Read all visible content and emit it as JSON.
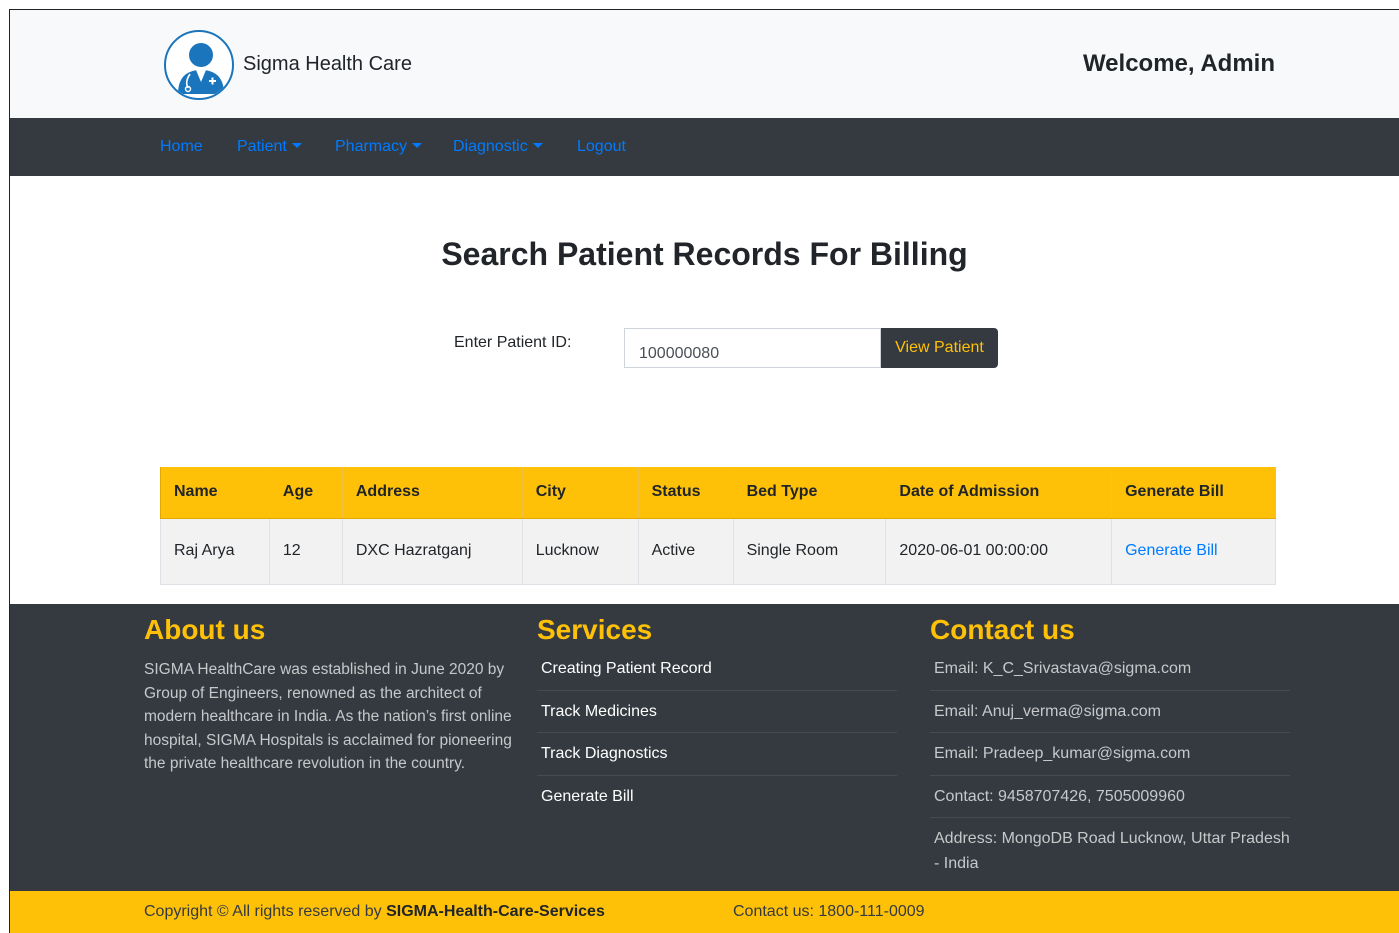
{
  "header": {
    "brand": "Sigma Health Care",
    "welcome": "Welcome, Admin"
  },
  "nav": {
    "home": "Home",
    "patient": "Patient",
    "pharmacy": "Pharmacy",
    "diagnostic": "Diagnostic",
    "logout": "Logout"
  },
  "main": {
    "title": "Search Patient Records For Billing",
    "search_label": "Enter Patient ID:",
    "search_value": "100000080",
    "view_button": "View Patient"
  },
  "table": {
    "headers": [
      "Name",
      "Age",
      "Address",
      "City",
      "Status",
      "Bed Type",
      "Date of Admission",
      "Generate Bill"
    ],
    "rows": [
      [
        "Raj Arya",
        "12",
        "DXC Hazratganj",
        "Lucknow",
        "Active",
        "Single Room",
        "2020-06-01 00:00:00",
        "Generate Bill"
      ]
    ]
  },
  "footer": {
    "about_title": "About us",
    "about_text": "SIGMA HealthCare was established in June 2020 by Group of Engineers, renowned as the architect of modern healthcare in India. As the nation’s first online hospital, SIGMA Hospitals is acclaimed for pioneering the private healthcare revolution in the country.",
    "services_title": "Services",
    "services": [
      "Creating Patient Record",
      "Track Medicines",
      "Track Diagnostics",
      "Generate Bill"
    ],
    "contact_title": "Contact us",
    "contacts": [
      "Email: K_C_Srivastava@sigma.com",
      "Email: Anuj_verma@sigma.com",
      "Email: Pradeep_kumar@sigma.com",
      "Contact: 9458707426, 7505009960",
      "Address: MongoDB Road Lucknow, Uttar Pradesh - India"
    ],
    "copyright_prefix": "Copyright © All rights reserved by ",
    "copyright_brand": "SIGMA-Health-Care-Services",
    "contact_line": "Contact us: 1800-111-0009"
  },
  "colors": {
    "accent": "#ffc107",
    "dark": "#343a40",
    "link": "#007bff",
    "logo_blue": "#1b75bc"
  },
  "icons": {
    "logo": "doctor-avatar-icon",
    "dropdown": "caret-down-icon"
  }
}
